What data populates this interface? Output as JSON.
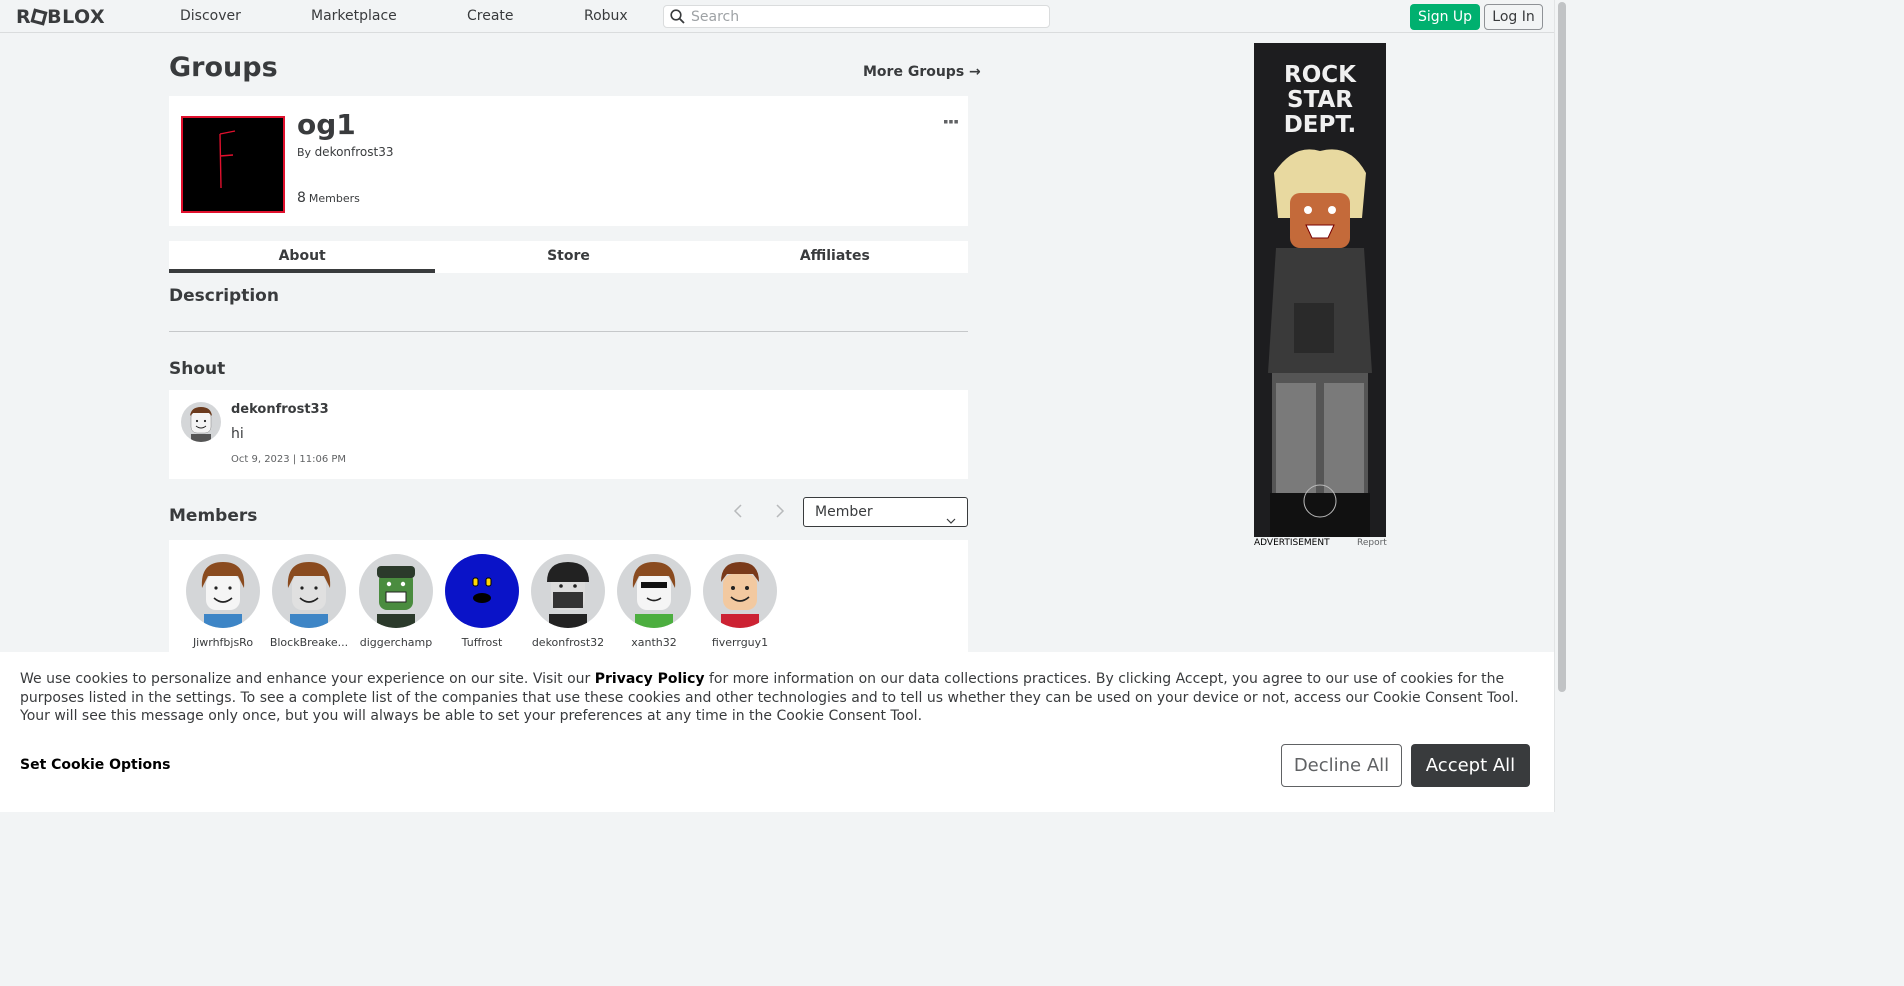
{
  "header": {
    "logo": "ROBLOX",
    "nav": [
      "Discover",
      "Marketplace",
      "Create",
      "Robux"
    ],
    "search_placeholder": "Search",
    "signup": "Sign Up",
    "login": "Log In"
  },
  "page": {
    "title": "Groups",
    "more_groups": "More Groups →"
  },
  "group": {
    "name": "og1",
    "by_label": "By",
    "owner": "dekonfrost33",
    "member_count": "8",
    "members_label": "Members"
  },
  "tabs": [
    "About",
    "Store",
    "Affiliates"
  ],
  "about": {
    "description_heading": "Description",
    "shout_heading": "Shout",
    "shout": {
      "user": "dekonfrost33",
      "text": "hi",
      "date": "Oct 9, 2023 | 11:06 PM"
    },
    "members_heading": "Members",
    "role_selected": "Member",
    "members": [
      {
        "name": "JiwrhfbjsRo",
        "color": "#3d85c6"
      },
      {
        "name": "BlockBreake...",
        "color": "#3d85c6"
      },
      {
        "name": "diggerchamp",
        "color": "#4a8c3f"
      },
      {
        "name": "Tuffrost",
        "color": "#0a13c8"
      },
      {
        "name": "dekonfrost32",
        "color": "#333333"
      },
      {
        "name": "xanth32",
        "color": "#4cae3f"
      },
      {
        "name": "fiverrguy1",
        "color": "#cc2233"
      }
    ]
  },
  "ad": {
    "title_line1": "ROCK",
    "title_line2": "STAR",
    "title_line3": "DEPT.",
    "label": "ADVERTISEMENT",
    "report": "Report"
  },
  "cookie": {
    "text_before": "We use cookies to personalize and enhance your experience on our site. Visit our ",
    "privacy_link": "Privacy Policy",
    "text_after": " for more information on our data collections practices. By clicking Accept, you agree to our use of cookies for the purposes listed in the settings. To see a complete list of the companies that use these cookies and other technologies and to tell us whether they can be used on your device or not, access our Cookie Consent Tool. Your will see this message only once, but you will always be able to set your preferences at any time in the Cookie Consent Tool.",
    "set_options": "Set Cookie Options",
    "decline": "Decline All",
    "accept": "Accept All"
  }
}
